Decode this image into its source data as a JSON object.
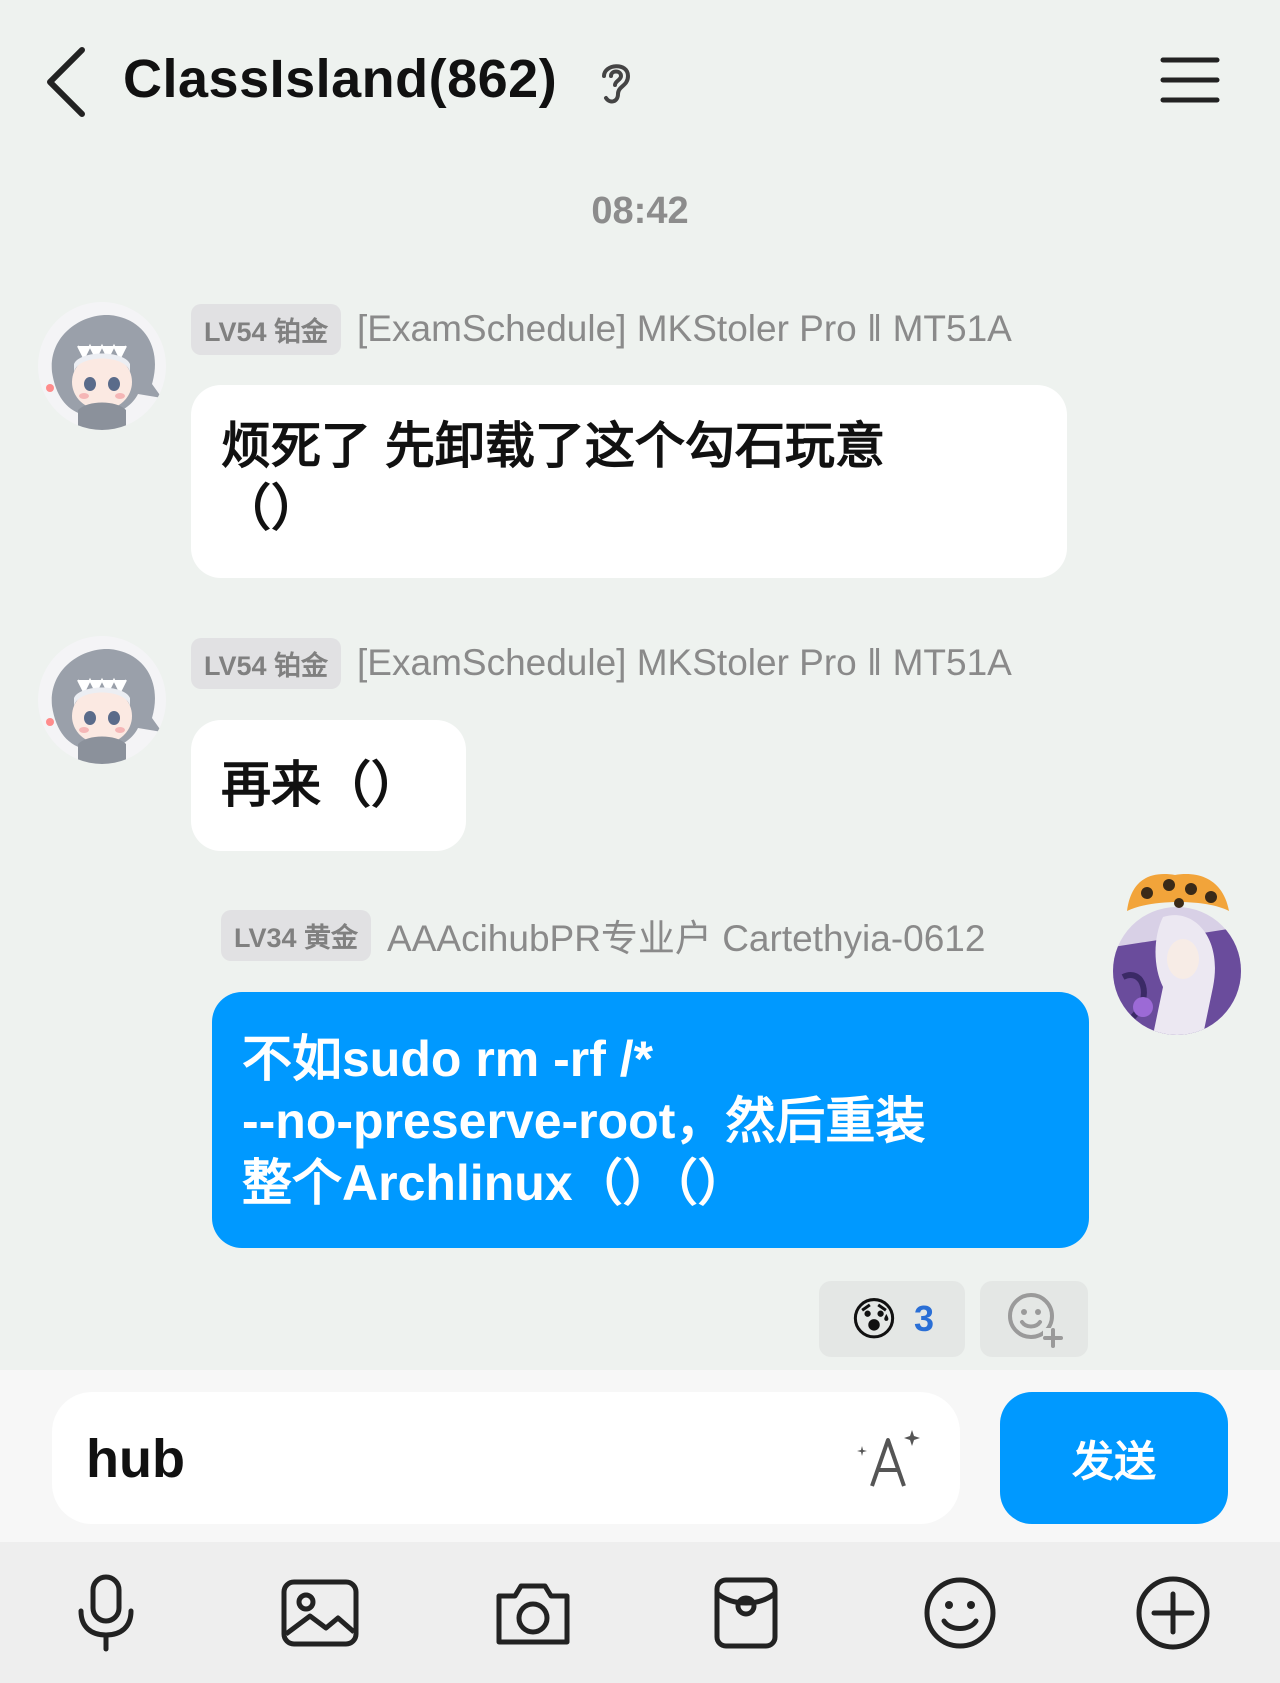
{
  "header": {
    "title": "ClassIsland(862)",
    "back_icon": "chevron-left-icon",
    "mode_icon": "ear-icon",
    "menu_icon": "hamburger-menu-icon"
  },
  "timestamp": "08:42",
  "messages": [
    {
      "level": "LV54 铂金",
      "sender": "[ExamSchedule] MKStoler Pro ‖ MT51A",
      "lines": [
        "烦死了 先卸载了这个勾石玩意",
        "（）"
      ],
      "direction": "incoming"
    },
    {
      "level": "LV54 铂金",
      "sender": "[ExamSchedule] MKStoler Pro ‖ MT51A",
      "lines": [
        "再来（）"
      ],
      "direction": "incoming"
    },
    {
      "level": "LV34 黄金",
      "sender": "AAAcihubPR专业户 Cartethyia-0612",
      "lines": [
        "不如sudo rm -rf /*",
        "--no-preserve-root，然后重装",
        "整个Archlinux（）（）"
      ],
      "direction": "outgoing"
    }
  ],
  "reaction": {
    "emoji": "😰",
    "count": "3",
    "add_icon": "add-reaction-icon"
  },
  "composer": {
    "value": "hub",
    "format_icon": "text-style-icon",
    "send_label": "发送"
  },
  "toolbar": {
    "icons": [
      "microphone-icon",
      "image-icon",
      "camera-icon",
      "red-packet-icon",
      "emoji-icon",
      "plus-icon"
    ]
  },
  "colors": {
    "background": "#eef2ef",
    "accent": "#0099ff",
    "bubble_in": "#ffffff",
    "muted_text": "#8a8a8a"
  }
}
